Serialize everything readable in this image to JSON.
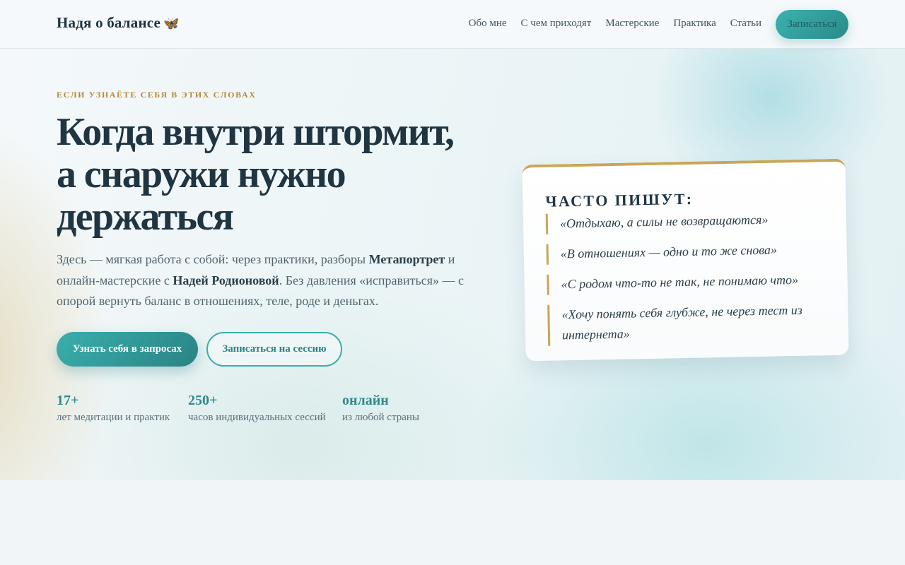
{
  "header": {
    "brand": "Надя о балансе",
    "brand_icon": "butterfly-icon",
    "nav": [
      "Обо мне",
      "С чем приходят",
      "Мастерские",
      "Практика",
      "Статьи"
    ],
    "cta": "Записаться"
  },
  "hero": {
    "eyebrow": "Если узнаёте себя в этих словах",
    "title": "Когда внутри штормит, а снаружи нужно держаться",
    "lead": {
      "p1": "Здесь — мягкая работа с собой: через практики, разборы ",
      "b1": "Метапортрет",
      "p2": " и онлайн-мастерские с ",
      "b2": "Надей Родионовой",
      "p3": ". Без давления «исправиться» — с опорой вернуть баланс в отношениях, теле, роде и деньгах."
    },
    "primary_button": "Узнать себя в запросах",
    "secondary_button": "Записаться на сессию",
    "stats": [
      {
        "value": "17+",
        "label": "лет медитации и практик"
      },
      {
        "value": "250+",
        "label": "часов индивидуальных сессий"
      },
      {
        "value": "онлайн",
        "label": "из любой страны"
      }
    ]
  },
  "card": {
    "title": "Часто пишут:",
    "quotes": [
      "«Отдыхаю, а силы не возвращаются»",
      "«В отношениях — одно и то же снова»",
      "«С родом что-то не так, не понимаю что»",
      "«Хочу понять себя глубже, не через тест из интернета»"
    ]
  },
  "colors": {
    "accent": "#2e8a8a",
    "gold": "#c9a657",
    "ink": "#1f3542"
  }
}
